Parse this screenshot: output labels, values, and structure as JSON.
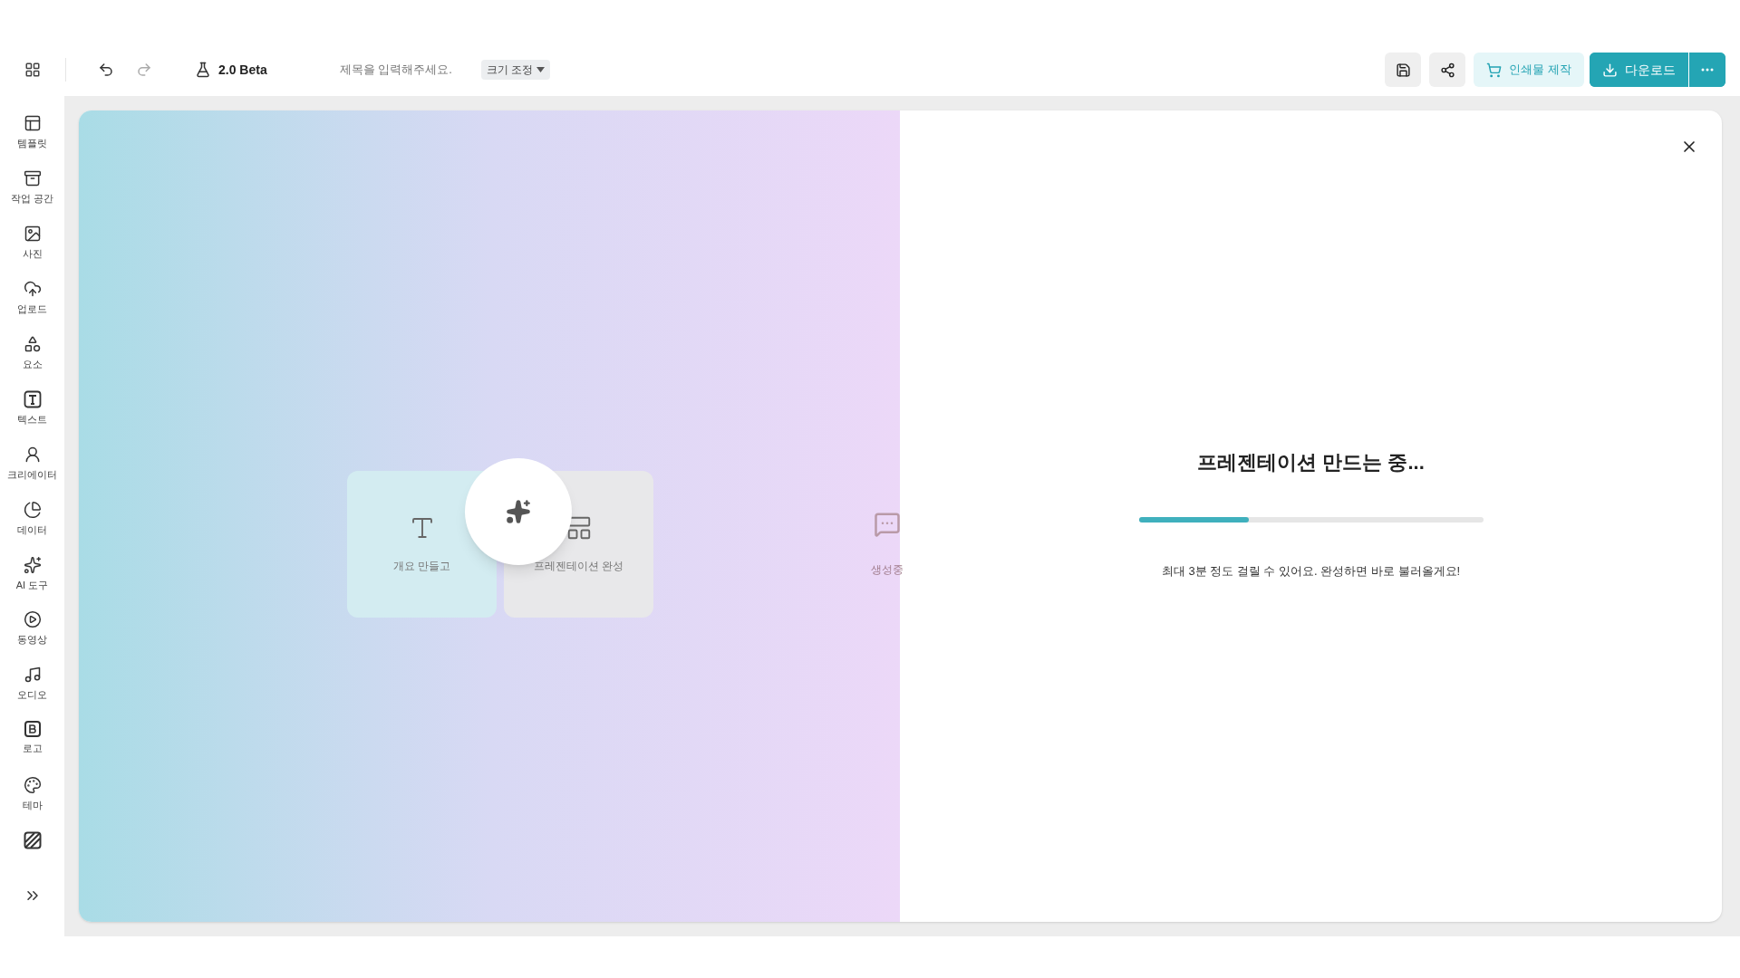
{
  "toolbar": {
    "version": "2.0 Beta",
    "title_placeholder": "제목을 입력해주세요.",
    "resize": "크기 조정",
    "print": "인쇄물 제작",
    "download": "다운로드"
  },
  "sidebar": {
    "items": [
      {
        "kind": "template",
        "label": "템플릿"
      },
      {
        "kind": "workspace",
        "label": "작업 공간"
      },
      {
        "kind": "photo",
        "label": "사진"
      },
      {
        "kind": "upload",
        "label": "업로드"
      },
      {
        "kind": "elements",
        "label": "요소"
      },
      {
        "kind": "text",
        "label": "텍스트"
      },
      {
        "kind": "creator",
        "label": "크리에이터"
      },
      {
        "kind": "data",
        "label": "데이터"
      },
      {
        "kind": "ai",
        "label": "AI 도구"
      },
      {
        "kind": "video",
        "label": "동영상"
      },
      {
        "kind": "audio",
        "label": "오디오"
      },
      {
        "kind": "logo",
        "label": "로고"
      },
      {
        "kind": "theme",
        "label": "테마"
      },
      {
        "kind": "pattern"
      },
      {
        "kind": "expand"
      }
    ]
  },
  "modal": {
    "steps": [
      {
        "kind": "outline",
        "label": "개요 만들고"
      },
      {
        "kind": "complete",
        "label": "프레젠테이션 완성"
      },
      {
        "kind": "generating",
        "label": "생성중"
      }
    ],
    "heading": "프레젠테이션 만드는 중...",
    "progress": {
      "level": 0.32
    },
    "note": "최대 3분 정도 걸릴 수 있어요. 완성하면 바로 불러올게요!"
  }
}
